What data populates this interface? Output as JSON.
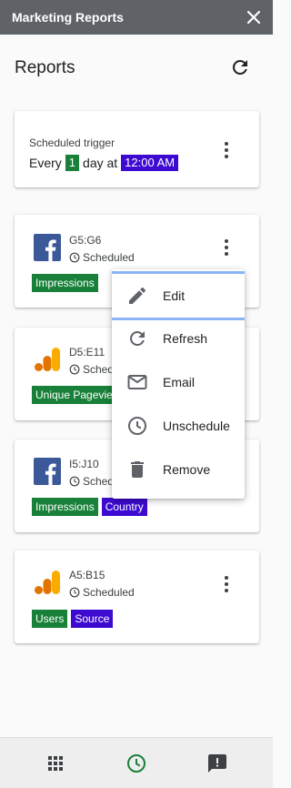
{
  "titlebar": {
    "title": "Marketing Reports"
  },
  "header": {
    "title": "Reports"
  },
  "trigger": {
    "label": "Scheduled trigger",
    "prefix": "Every",
    "count": "1",
    "unit": "day at",
    "time": "12:00 AM"
  },
  "reports": [
    {
      "source": "facebook-logo",
      "range": "G5:G6",
      "status": "Scheduled",
      "chips": [
        {
          "label": "Impressions",
          "color": "#188038"
        }
      ]
    },
    {
      "source": "analytics-logo",
      "range": "D5:E11",
      "status": "Scheduled",
      "chips": [
        {
          "label": "Unique Pageviews",
          "color": "#188038"
        }
      ]
    },
    {
      "source": "facebook-logo",
      "range": "I5:J10",
      "status": "Scheduled",
      "chips": [
        {
          "label": "Impressions",
          "color": "#188038"
        },
        {
          "label": "Country",
          "color": "#3d0ad1"
        }
      ]
    },
    {
      "source": "analytics-logo",
      "range": "A5:B15",
      "status": "Scheduled",
      "chips": [
        {
          "label": "Users",
          "color": "#188038"
        },
        {
          "label": "Source",
          "color": "#3d0ad1"
        }
      ]
    }
  ],
  "menu": {
    "items": [
      {
        "label": "Edit",
        "icon": "pencil-icon"
      },
      {
        "label": "Refresh",
        "icon": "refresh-icon"
      },
      {
        "label": "Email",
        "icon": "mail-icon"
      },
      {
        "label": "Unschedule",
        "icon": "clock-icon"
      },
      {
        "label": "Remove",
        "icon": "trash-icon"
      }
    ]
  },
  "bottom_nav": [
    {
      "name": "grid-icon"
    },
    {
      "name": "clock-icon",
      "active_color": "#188038"
    },
    {
      "name": "feedback-icon"
    }
  ]
}
